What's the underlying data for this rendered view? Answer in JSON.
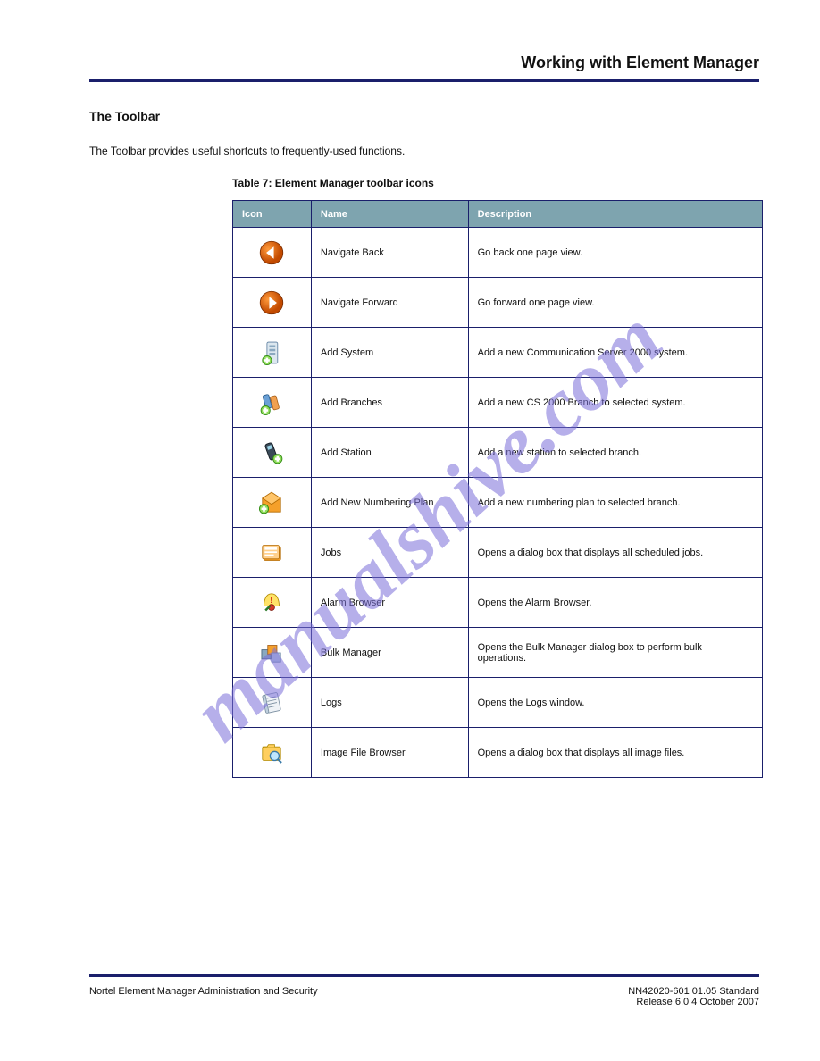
{
  "header": {
    "right": "Working with Element Manager"
  },
  "section": {
    "title": "The Toolbar",
    "intro": "The Toolbar provides useful shortcuts to frequently-used functions."
  },
  "table": {
    "caption": "Table 7: Element Manager toolbar icons",
    "columns": [
      "Icon",
      "Name",
      "Description"
    ],
    "rows": [
      {
        "name": "Navigate Back",
        "desc": "Go back one page view."
      },
      {
        "name": "Navigate Forward",
        "desc": "Go forward one page view."
      },
      {
        "name": "Add System",
        "desc": "Add a new Communication Server 2000 system."
      },
      {
        "name": "Add Branches",
        "desc": "Add a new CS 2000 Branch to selected system."
      },
      {
        "name": "Add Station",
        "desc": "Add a new station to selected branch."
      },
      {
        "name": "Add New Numbering Plan",
        "desc": "Add a new numbering plan to selected branch."
      },
      {
        "name": "Jobs",
        "desc": "Opens a dialog box that displays all scheduled jobs."
      },
      {
        "name": "Alarm Browser",
        "desc": "Opens the Alarm Browser."
      },
      {
        "name": "Bulk Manager",
        "desc": "Opens the Bulk Manager dialog box to perform bulk operations."
      },
      {
        "name": "Logs",
        "desc": "Opens the Logs window."
      },
      {
        "name": "Image File Browser",
        "desc": "Opens a dialog box that displays all image files."
      }
    ]
  },
  "footer": {
    "left": "Nortel Element Manager Administration and Security",
    "right": "NN42020-601 01.05 Standard",
    "right2": "Release 6.0 4 October 2007"
  },
  "watermark": "manualshive.com"
}
